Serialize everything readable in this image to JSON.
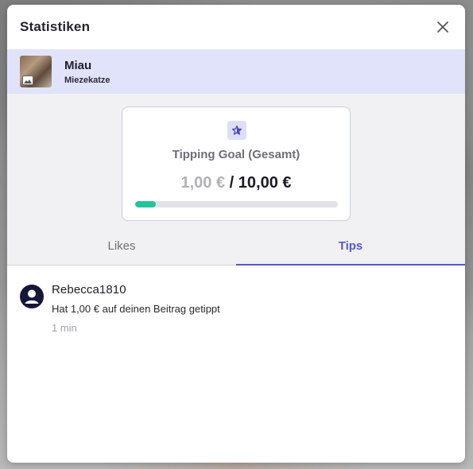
{
  "modal": {
    "title": "Statistiken",
    "close_icon": "close-icon"
  },
  "profile": {
    "name": "Miau",
    "handle": "Miezekatze",
    "thumbnail_icon": "image-icon"
  },
  "goal": {
    "icon": "star-badge-icon",
    "title": "Tipping Goal (Gesamt)",
    "current": "1,00 €",
    "separator": " / ",
    "target": "10,00 €",
    "progress_fraction": 0.1,
    "progress_color": "#23c49a"
  },
  "tabs": [
    {
      "label": "Likes",
      "active": false
    },
    {
      "label": "Tips",
      "active": true
    }
  ],
  "accent_color": "#5b55c7",
  "tips": [
    {
      "user": "Rebecca1810",
      "message": "Hat 1,00 € auf deinen Beitrag getippt",
      "time": "1 min",
      "avatar_icon": "user-circle-icon"
    }
  ]
}
